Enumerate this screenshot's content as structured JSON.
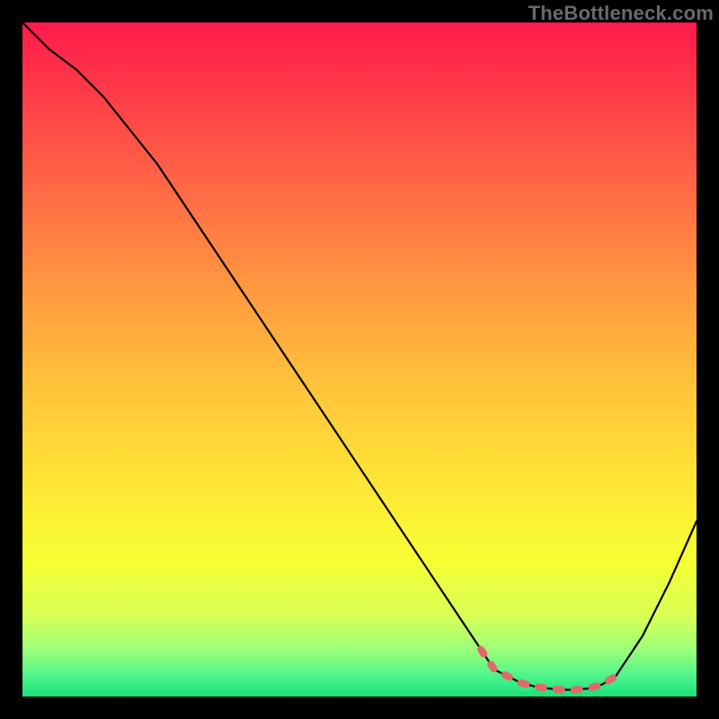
{
  "watermark": "TheBottleneck.com",
  "chart_data": {
    "type": "line",
    "title": "",
    "xlabel": "",
    "ylabel": "",
    "xlim": [
      0,
      100
    ],
    "ylim": [
      0,
      100
    ],
    "grid": false,
    "legend": false,
    "series": [
      {
        "name": "curve",
        "x": [
          0,
          4,
          8,
          12,
          16,
          20,
          24,
          28,
          32,
          36,
          40,
          44,
          48,
          52,
          56,
          60,
          64,
          68,
          70,
          72,
          74,
          76,
          78,
          80,
          82,
          84,
          86,
          88,
          92,
          96,
          100
        ],
        "y": [
          100,
          96,
          93,
          89,
          84,
          79,
          73,
          67,
          61,
          55,
          49,
          43,
          37,
          31,
          25,
          19,
          13,
          7,
          4,
          3,
          2,
          1.5,
          1.2,
          1,
          1,
          1.2,
          1.8,
          3,
          9,
          17,
          26
        ]
      },
      {
        "name": "highlight",
        "x": [
          68,
          70,
          72,
          74,
          76,
          78,
          80,
          82,
          84,
          86,
          88
        ],
        "y": [
          7,
          4,
          3,
          2,
          1.5,
          1.2,
          1,
          1,
          1.2,
          1.8,
          3
        ]
      }
    ],
    "gradient_stops": [
      {
        "offset": 0.0,
        "color": "#ff1a4b"
      },
      {
        "offset": 0.1,
        "color": "#ff3a48"
      },
      {
        "offset": 0.25,
        "color": "#ff6a45"
      },
      {
        "offset": 0.4,
        "color": "#ff9a40"
      },
      {
        "offset": 0.55,
        "color": "#ffc63a"
      },
      {
        "offset": 0.7,
        "color": "#ffe935"
      },
      {
        "offset": 0.8,
        "color": "#f6ff33"
      },
      {
        "offset": 0.88,
        "color": "#d8ff55"
      },
      {
        "offset": 0.93,
        "color": "#9dff7a"
      },
      {
        "offset": 0.97,
        "color": "#4cf58a"
      },
      {
        "offset": 1.0,
        "color": "#17e07a"
      }
    ]
  }
}
